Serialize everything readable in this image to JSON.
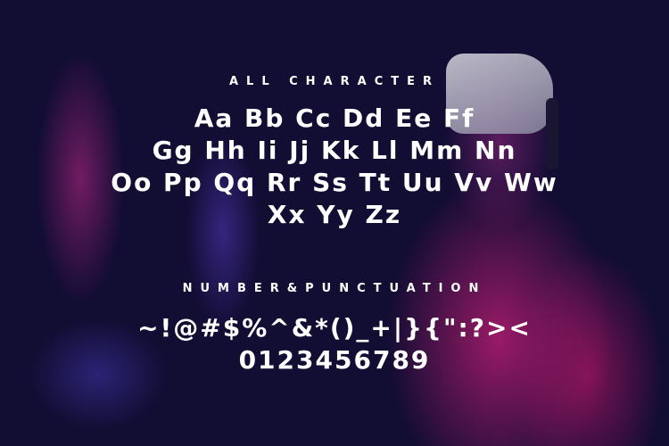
{
  "all_character": {
    "heading": "ALL CHARACTER",
    "lines": [
      "Aa Bb Cc Dd Ee Ff",
      "Gg Hh Ii Jj Kk Ll Mm Nn",
      "Oo Pp Qq Rr Ss Tt Uu Vv Ww",
      "Xx Yy Zz"
    ]
  },
  "number_punctuation": {
    "heading": "NUMBER&PUNCTUATION",
    "punctuation": "~!@#$%^&*()_+|}{\":?><",
    "numbers": "0123456789"
  },
  "colors": {
    "background": "#120d33",
    "accent_magenta": "#c81e78",
    "text": "#ffffff"
  }
}
